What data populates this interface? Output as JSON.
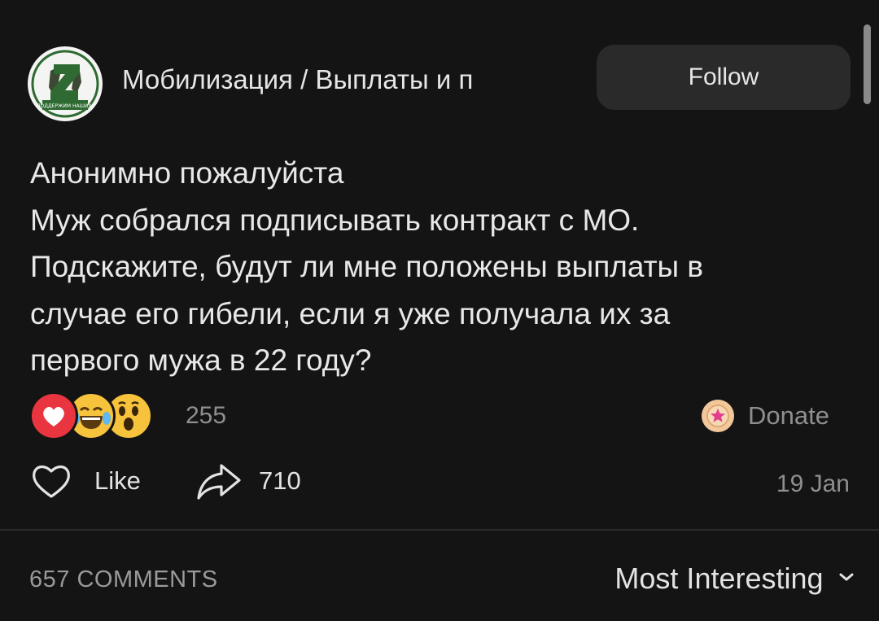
{
  "header": {
    "channel_name": "Мобилизация / Выплаты и п",
    "follow_label": "Follow",
    "avatar_text": "ПОДДЕРЖИМ НАШИХ!"
  },
  "post": {
    "lines": [
      "Анонимно пожалуйста",
      "Муж собрался подписывать контракт с МО.",
      "Подскажите, будут ли мне положены выплаты в",
      "случае его гибели, если я уже получала их за",
      "первого мужа в 22 году?"
    ]
  },
  "reactions": {
    "icons": [
      "heart-reaction-icon",
      "laughing-tears-reaction-icon",
      "surprised-reaction-icon"
    ],
    "count": "255"
  },
  "donate": {
    "label": "Donate",
    "icon": "star-coin-icon"
  },
  "actions": {
    "like_label": "Like",
    "share_count": "710",
    "date": "19 Jan"
  },
  "comments": {
    "count_label": "657 COMMENTS",
    "sort_label": "Most Interesting"
  },
  "colors": {
    "background": "#141414",
    "button": "#2a2a2a",
    "text": "#e8e8e8",
    "muted": "#8f8f8f",
    "heart": "#e8353f",
    "emoji": "#f7c23c",
    "avatar_green": "#2e6a32"
  }
}
